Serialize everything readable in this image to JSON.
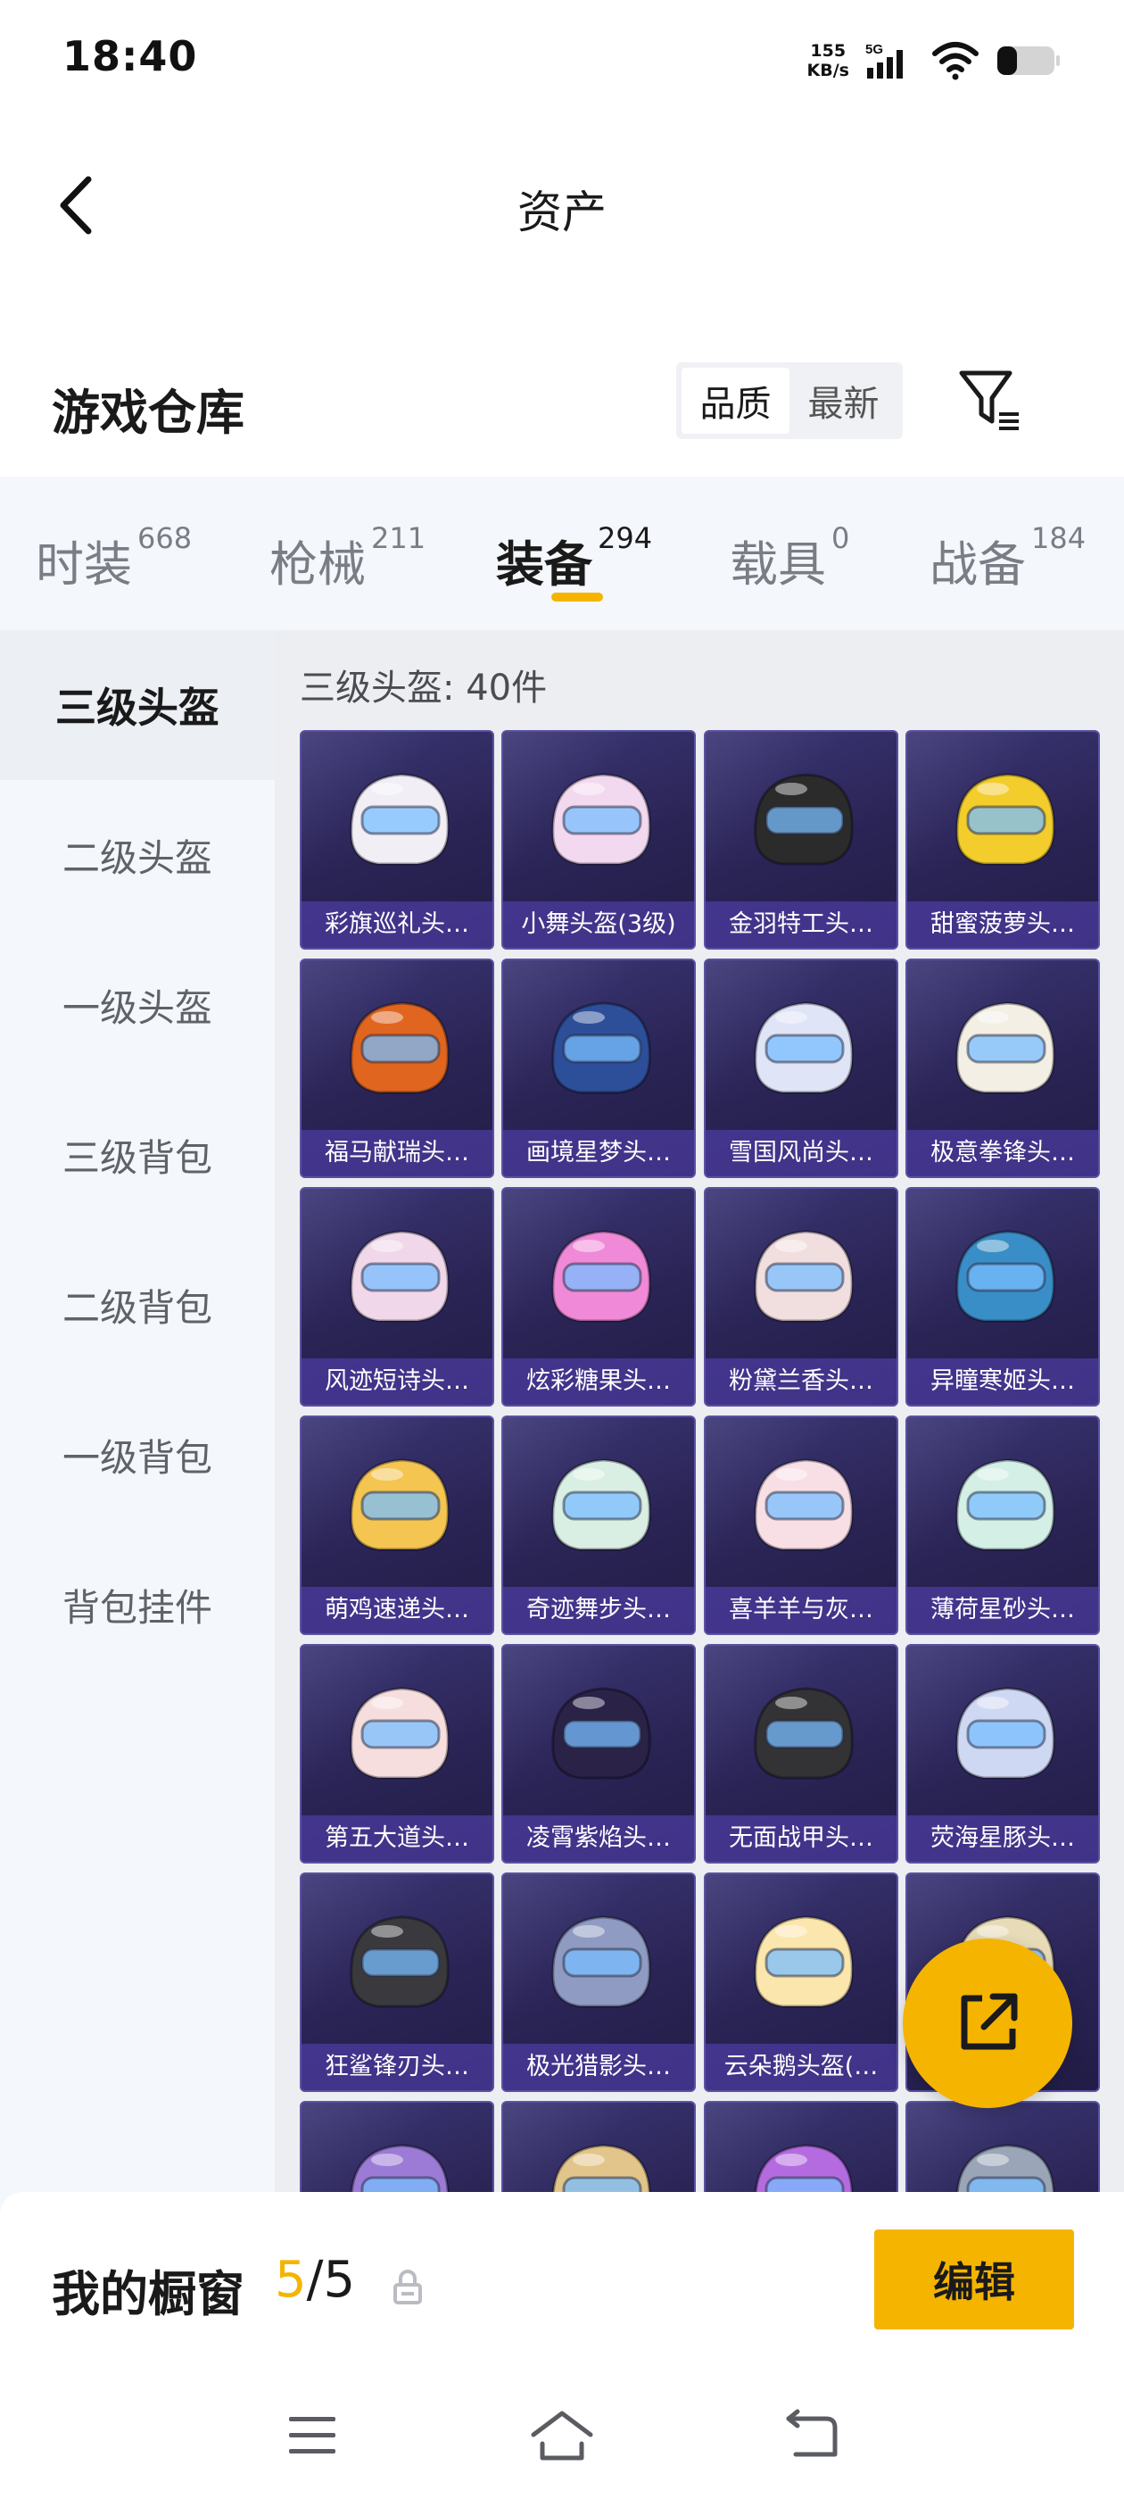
{
  "status_bar": {
    "time": "18:40",
    "net_speed_value": "155",
    "net_speed_unit": "KB/s",
    "network_type": "5G",
    "battery_level": 0.35
  },
  "header": {
    "title": "资产"
  },
  "warehouse": {
    "title": "游戏仓库",
    "sort_options": [
      "品质",
      "最新"
    ],
    "sort_selected": "品质"
  },
  "tabs": [
    {
      "label": "时装",
      "count": "668"
    },
    {
      "label": "枪械",
      "count": "211"
    },
    {
      "label": "装备",
      "count": "294",
      "active": true
    },
    {
      "label": "载具",
      "count": "0"
    },
    {
      "label": "战备",
      "count": "184"
    }
  ],
  "sidebar": {
    "items": [
      "三级头盔",
      "二级头盔",
      "一级头盔",
      "三级背包",
      "二级背包",
      "一级背包",
      "背包挂件"
    ],
    "active": "三级头盔"
  },
  "section": {
    "label": "三级头盔: 40件"
  },
  "items": [
    "彩旗巡礼头…",
    "小舞头盔(3级)",
    "金羽特工头…",
    "甜蜜菠萝头…",
    "福马献瑞头…",
    "画境星梦头…",
    "雪国风尚头…",
    "极意拳锋头…",
    "风迹短诗头…",
    "炫彩糖果头…",
    "粉黛兰香头…",
    "异瞳寒姬头…",
    "萌鸡速递头…",
    "奇迹舞步头…",
    "喜羊羊与灰…",
    "薄荷星砂头…",
    "第五大道头…",
    "凌霄紫焰头…",
    "无面战甲头…",
    "荧海星豚头…",
    "狂鲨锋刃头…",
    "极光猎影头…",
    "云朵鹅头盔(…",
    "",
    "",
    "",
    "",
    ""
  ],
  "item_colors": [
    "#f1eef6",
    "#f3d9ef",
    "#2b2b2b",
    "#f2cd2c",
    "#e0651f",
    "#2d4f9a",
    "#dfe4f6",
    "#f3efe4",
    "#f0d8ea",
    "#f08ad8",
    "#f1dede",
    "#3a8ec7",
    "#f4c551",
    "#d9efe3",
    "#f7dfe5",
    "#d4efe6",
    "#f6dede",
    "#2b2248",
    "#333336",
    "#cfd8f3",
    "#3a3a3e",
    "#8f9bc2",
    "#fbe6ad",
    "#e7dbb8",
    "#9b7bd6",
    "#e2c58a",
    "#b46be0",
    "#9aa6b8"
  ],
  "showcase": {
    "label": "我的橱窗",
    "current": "5",
    "separator": "/",
    "total": "5",
    "edit_label": "编辑"
  },
  "colors": {
    "accent": "#f5b400",
    "card_bg": "#2e2860",
    "card_border": "#5a52a3"
  }
}
